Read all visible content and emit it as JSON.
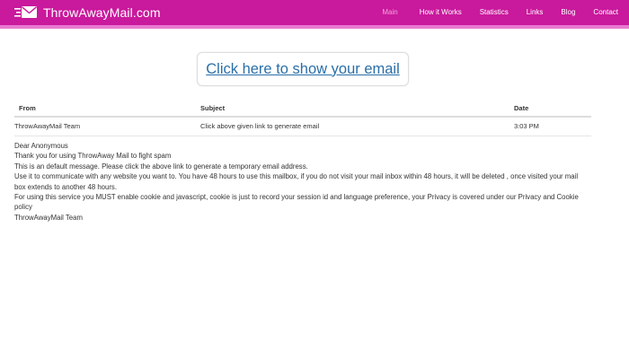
{
  "header": {
    "brand": "ThrowAwayMail.com",
    "logo_icon": "envelope-speed-icon",
    "nav": [
      {
        "label": "Main",
        "active": true
      },
      {
        "label": "How it Works",
        "active": false
      },
      {
        "label": "Statistics",
        "active": false
      },
      {
        "label": "Links",
        "active": false
      },
      {
        "label": "Blog",
        "active": false
      },
      {
        "label": "Contact",
        "active": false
      }
    ],
    "colors": {
      "bar": "#c9199c",
      "stripe": "#e87ad0",
      "active_link": "#f4a6de"
    }
  },
  "show_email": {
    "label": "Click here to show your email",
    "color": "#2a6fa8"
  },
  "inbox": {
    "columns": {
      "from": "From",
      "subject": "Subject",
      "date": "Date"
    },
    "rows": [
      {
        "from": "ThrowAwayMail Team",
        "subject": "Click above given link to generate email",
        "date": "3:03 PM"
      }
    ]
  },
  "message": {
    "lines": [
      "Dear Anonymous",
      "Thank you for using ThrowAway Mail to fight spam",
      "This is an default message. Please click the above link to generate a temporary email address.",
      "Use it to communicate with any website you want to. You have 48 hours to use this mailbox, if you do not visit your mail inbox within 48 hours, it will be deleted , once visited your mail box extends to another 48 hours.",
      "For using this service you MUST enable cookie and javascript, cookie is just to record your session id and language preference, your Privacy is covered under our Privacy and Cookie policy",
      "ThrowAwayMail Team"
    ]
  }
}
